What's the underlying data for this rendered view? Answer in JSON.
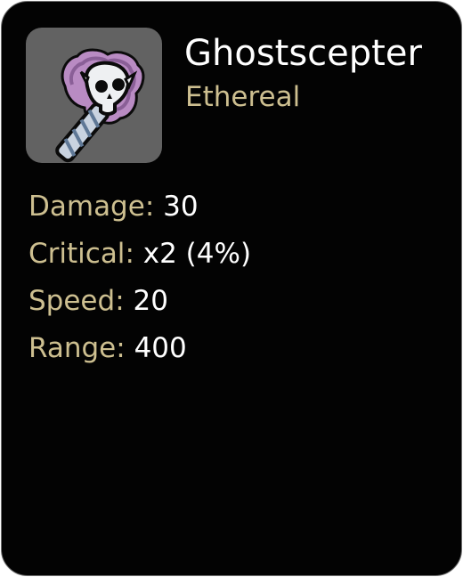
{
  "item": {
    "name": "Ghostscepter",
    "type": "Ethereal",
    "icon": "ghost-scepter-icon"
  },
  "stats": [
    {
      "label": "Damage",
      "value": "30"
    },
    {
      "label": "Critical",
      "value": "x2 (4%)"
    },
    {
      "label": "Speed",
      "value": "20"
    },
    {
      "label": "Range",
      "value": "400"
    }
  ],
  "punctuation": {
    "colon": ":"
  },
  "colors": {
    "card_background": "#030303",
    "icon_background": "#626262",
    "accent_label": "#cdbf90",
    "value_text": "#ffffff",
    "ghost_glow": "#b98bc3"
  }
}
